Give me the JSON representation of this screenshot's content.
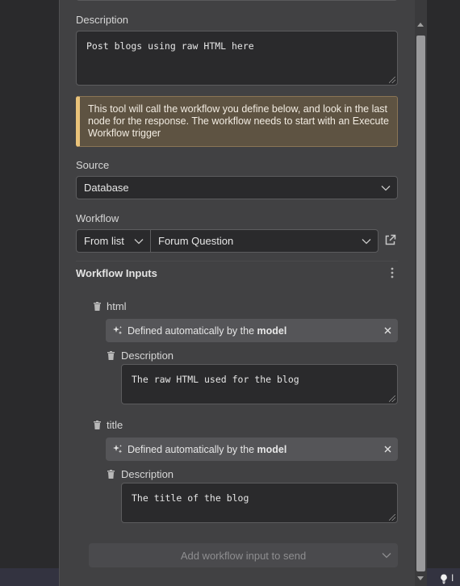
{
  "description_section": {
    "label": "Description",
    "value": "Post blogs using raw HTML here"
  },
  "notice": {
    "text": "This tool will call the workflow you define below, and look in the last node for the response. The workflow needs to start with an Execute Workflow trigger"
  },
  "source": {
    "label": "Source",
    "selected": "Database"
  },
  "workflow": {
    "label": "Workflow",
    "mode_selected": "From list",
    "selected": "Forum Question"
  },
  "workflow_inputs": {
    "label": "Workflow Inputs",
    "items": [
      {
        "name": "html",
        "pill_prefix": "Defined automatically by the ",
        "pill_strong": "model",
        "description_label": "Description",
        "description_value": "The raw HTML used for the blog"
      },
      {
        "name": "title",
        "pill_prefix": "Defined automatically by the ",
        "pill_strong": "model",
        "description_label": "Description",
        "description_value": "The title of the blog"
      }
    ],
    "add_button_label": "Add workflow input to send"
  },
  "footer": {
    "hint_text": "I"
  },
  "icons": {
    "trash": "trash-icon",
    "sparkle": "sparkles-icon",
    "close": "close-icon",
    "chevron": "chevron-down-icon",
    "external": "external-link-icon",
    "kebab": "kebab-menu-icon",
    "bulb": "lightbulb-icon"
  },
  "colors": {
    "panel_bg": "#414143",
    "field_bg": "#2a2a2c",
    "notice_bg": "#5e5342",
    "notice_accent": "#e8c27a",
    "pill_bg": "#555558"
  }
}
